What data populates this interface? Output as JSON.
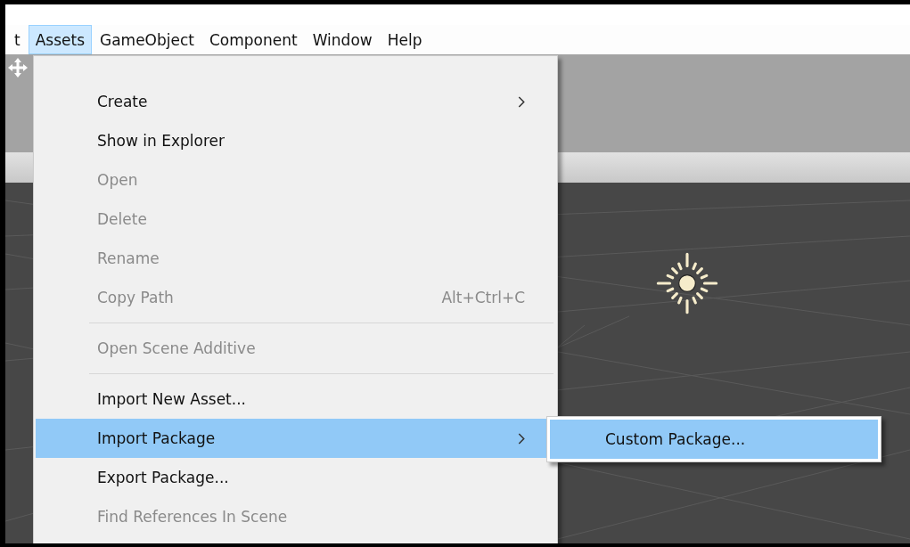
{
  "menu_bar": [
    {
      "label": "t",
      "selected": false
    },
    {
      "label": "Assets",
      "selected": true
    },
    {
      "label": "GameObject",
      "selected": false
    },
    {
      "label": "Component",
      "selected": false
    },
    {
      "label": "Window",
      "selected": false
    },
    {
      "label": "Help",
      "selected": false
    }
  ],
  "menu": [
    {
      "kind": "item",
      "label": "Create",
      "disabled": false,
      "submenu": true,
      "selected": false
    },
    {
      "kind": "item",
      "label": "Show in Explorer",
      "disabled": false,
      "submenu": false,
      "selected": false
    },
    {
      "kind": "item",
      "label": "Open",
      "disabled": true,
      "submenu": false,
      "selected": false
    },
    {
      "kind": "item",
      "label": "Delete",
      "disabled": true,
      "submenu": false,
      "selected": false
    },
    {
      "kind": "item",
      "label": "Rename",
      "disabled": true,
      "submenu": false,
      "selected": false
    },
    {
      "kind": "item",
      "label": "Copy Path",
      "shortcut": "Alt+Ctrl+C",
      "disabled": true,
      "submenu": false,
      "selected": false
    },
    {
      "kind": "separator"
    },
    {
      "kind": "item",
      "label": "Open Scene Additive",
      "disabled": true,
      "submenu": false,
      "selected": false
    },
    {
      "kind": "separator"
    },
    {
      "kind": "item",
      "label": "Import New Asset...",
      "disabled": false,
      "submenu": false,
      "selected": false
    },
    {
      "kind": "item",
      "label": "Import Package",
      "disabled": false,
      "submenu": true,
      "selected": true
    },
    {
      "kind": "item",
      "label": "Export Package...",
      "disabled": false,
      "submenu": false,
      "selected": false
    },
    {
      "kind": "item",
      "label": "Find References In Scene",
      "disabled": true,
      "submenu": false,
      "selected": false
    }
  ],
  "submenu": [
    {
      "label": "Custom Package...",
      "selected": true
    }
  ]
}
